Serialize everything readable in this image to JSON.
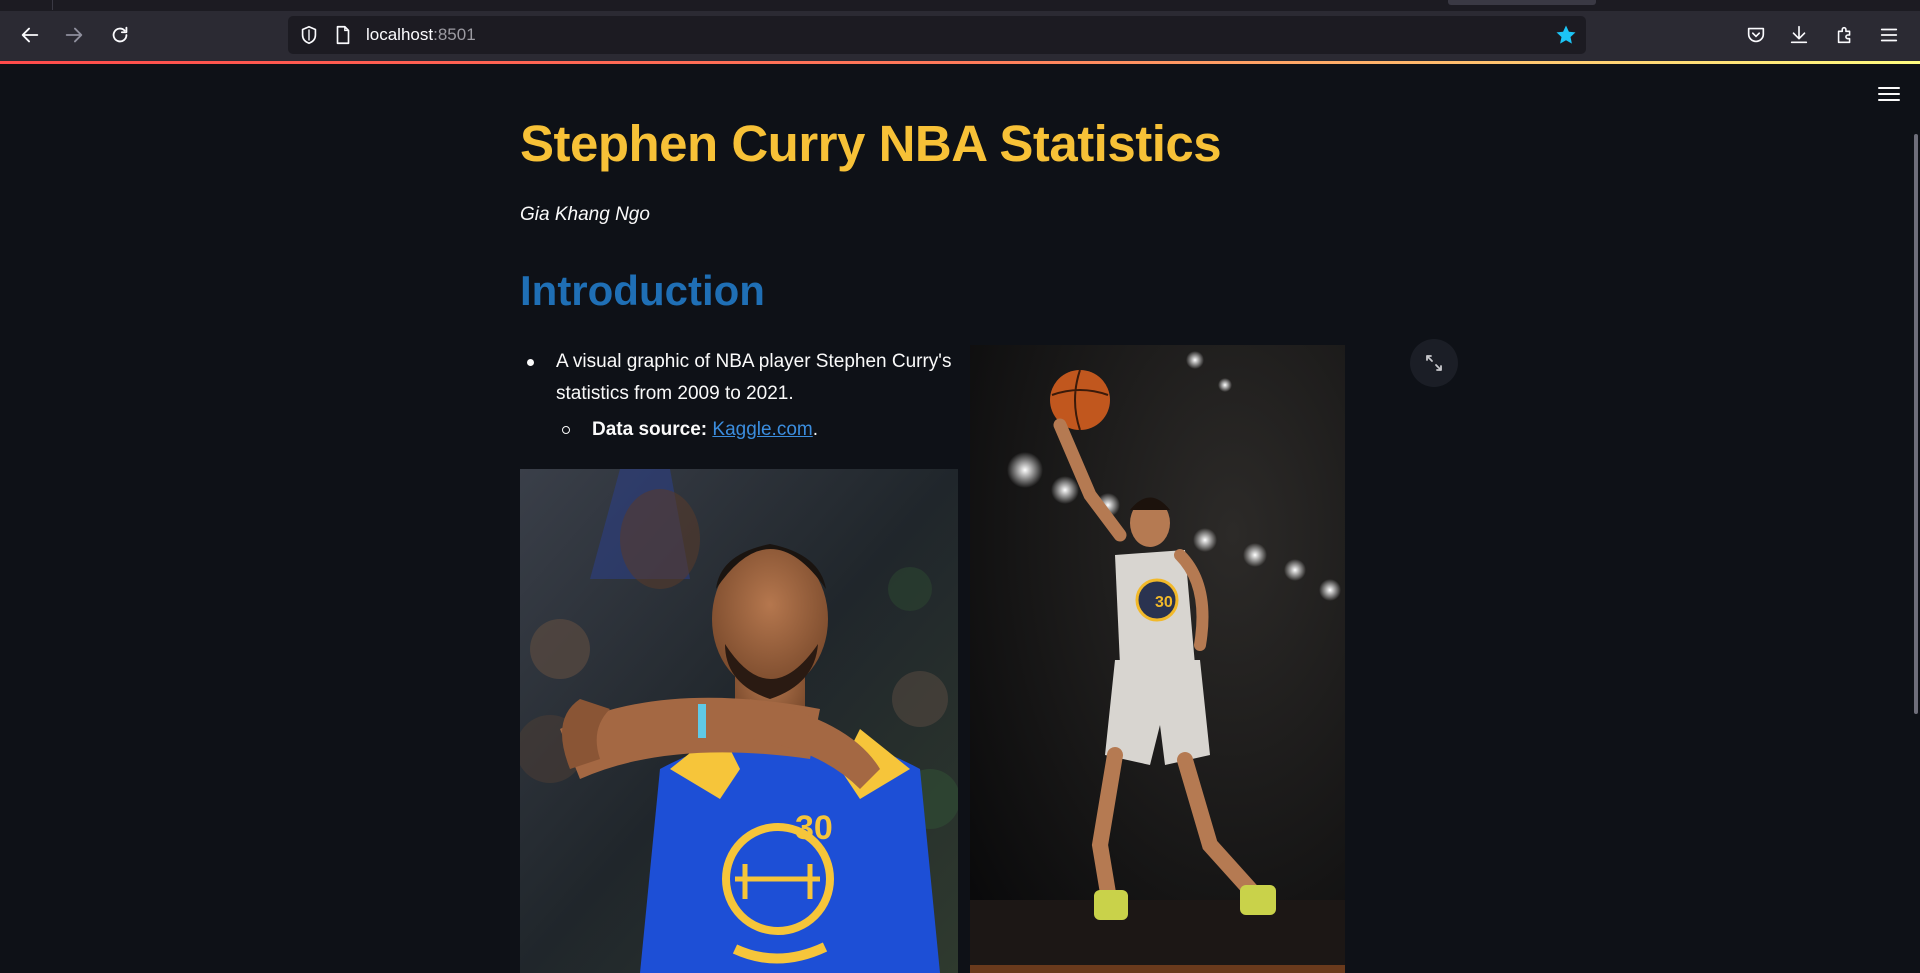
{
  "browser": {
    "url_host": "localhost",
    "url_port": ":8501",
    "accent_color": "#1cc4f5"
  },
  "page": {
    "title": "Stephen Curry NBA Statistics",
    "author": "Gia Khang Ngo",
    "section_heading": "Introduction",
    "bullets": {
      "item1": "A visual graphic of NBA player Stephen Curry's statistics from 2009 to 2021.",
      "sub_label": "Data source:",
      "sub_link": "Kaggle.com",
      "sub_suffix": "."
    },
    "images": [
      {
        "alt": "Stephen Curry in blue Warriors #30 jersey"
      },
      {
        "alt": "Stephen Curry leaping for a layup in white Warriors #30 jersey"
      }
    ]
  },
  "colors": {
    "background": "#0e1117",
    "title": "#f7c137",
    "heading": "#1f6fb5",
    "link": "#3b8dde"
  },
  "icons": [
    "back-arrow-icon",
    "forward-arrow-icon",
    "reload-icon",
    "shield-icon",
    "page-icon",
    "bookmark-star-icon",
    "pocket-icon",
    "download-icon",
    "extensions-icon",
    "menu-icon",
    "hamburger-icon",
    "fullscreen-icon"
  ]
}
